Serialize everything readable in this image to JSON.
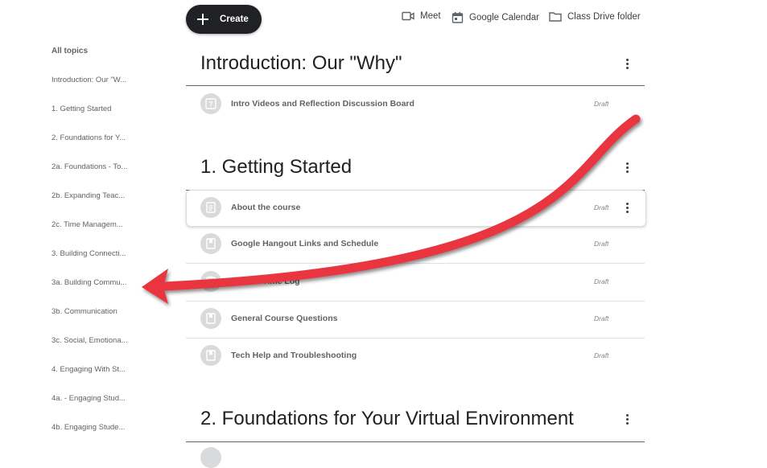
{
  "topbar": {
    "create_label": "Create",
    "meet_label": "Meet",
    "calendar_label": "Google Calendar",
    "drive_label": "Class Drive folder"
  },
  "sidebar": {
    "heading": "All topics",
    "items": [
      "Introduction: Our \"W...",
      "1. Getting Started",
      "2. Foundations for Y...",
      "2a. Foundations - To...",
      "2b. Expanding Teac...",
      "2c. Time Managem...",
      "3. Building Connecti...",
      "3a. Building Commu...",
      "3b. Communication",
      "3c. Social, Emotiona...",
      "4. Engaging With St...",
      "4a. - Engaging Stud...",
      "4b. Engaging Stude..."
    ]
  },
  "sections": [
    {
      "title": "Introduction: Our \"Why\"",
      "items": [
        {
          "title": "Intro Videos and Reflection Discussion Board",
          "status": "Draft",
          "icon": "question-icon"
        }
      ]
    },
    {
      "title": "1. Getting Started",
      "items": [
        {
          "title": "About the course",
          "status": "Draft",
          "icon": "material-icon"
        },
        {
          "title": "Google Hangout Links and Schedule",
          "status": "Draft",
          "icon": "bookmark-icon"
        },
        {
          "title": "Course Time Log",
          "status": "Draft",
          "icon": "assignment-icon"
        },
        {
          "title": "General Course Questions",
          "status": "Draft",
          "icon": "bookmark-icon"
        },
        {
          "title": "Tech Help and Troubleshooting",
          "status": "Draft",
          "icon": "bookmark-icon"
        }
      ]
    },
    {
      "title": "2. Foundations for Your Virtual Environment",
      "items": []
    }
  ],
  "colors": {
    "arrow": "#e8353f",
    "create_bg": "#202124"
  }
}
